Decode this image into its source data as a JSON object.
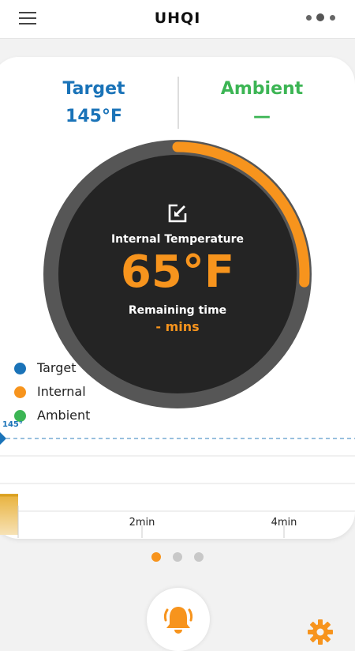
{
  "app": {
    "title": "UHQI"
  },
  "icons": {
    "menu": "menu-icon",
    "more": "more-dots-icon",
    "edit": "edit-arrow-icon",
    "bell": "bell-icon",
    "settings": "gear-icon"
  },
  "colors": {
    "target": "#1a73b8",
    "ambient": "#3cb554",
    "internal": "#f7941d",
    "gauge_bg": "#242424",
    "gauge_ring": "#565656"
  },
  "summary": {
    "target_label": "Target",
    "target_value": "145°F",
    "ambient_label": "Ambient",
    "ambient_value": "—"
  },
  "gauge": {
    "label": "Internal Temperature",
    "value": "65°F",
    "remaining_label": "Remaining time",
    "remaining_value": "- mins",
    "progress_fraction": 0.26
  },
  "legend": [
    {
      "label": "Target",
      "color": "#1a73b8"
    },
    {
      "label": "Internal",
      "color": "#f7941d"
    },
    {
      "label": "Ambient",
      "color": "#3cb554"
    }
  ],
  "chart_data": {
    "type": "line",
    "target_line_label": "145°",
    "x_ticks": [
      "2min",
      "4min"
    ]
  },
  "pager": {
    "count": 3,
    "active_index": 0
  }
}
